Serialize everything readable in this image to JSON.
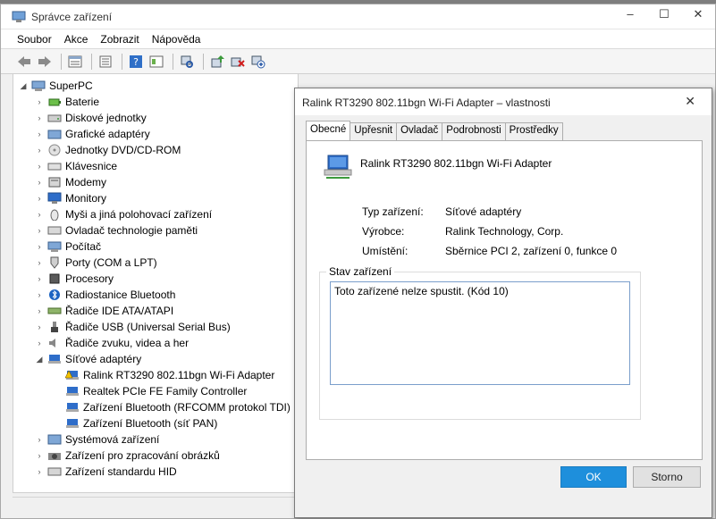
{
  "main_window": {
    "title": "Správce zařízení",
    "controls": {
      "minimize": "–",
      "maximize": "☐",
      "close": "✕"
    }
  },
  "menu": [
    "Soubor",
    "Akce",
    "Zobrazit",
    "Nápověda"
  ],
  "tree": {
    "root": "SuperPC",
    "items": [
      {
        "label": "Baterie",
        "icon": "battery-icon",
        "expanded": false
      },
      {
        "label": "Diskové jednotky",
        "icon": "disk-drive-icon",
        "expanded": false
      },
      {
        "label": "Grafické adaptéry",
        "icon": "display-adapter-icon",
        "expanded": false
      },
      {
        "label": "Jednotky DVD/CD-ROM",
        "icon": "dvd-drive-icon",
        "expanded": false
      },
      {
        "label": "Klávesnice",
        "icon": "keyboard-icon",
        "expanded": false
      },
      {
        "label": "Modemy",
        "icon": "modem-icon",
        "expanded": false
      },
      {
        "label": "Monitory",
        "icon": "monitor-icon",
        "expanded": false
      },
      {
        "label": "Myši a jiná polohovací zařízení",
        "icon": "mouse-icon",
        "expanded": false
      },
      {
        "label": "Ovladač technologie paměti",
        "icon": "memory-controller-icon",
        "expanded": false
      },
      {
        "label": "Počítač",
        "icon": "computer-icon",
        "expanded": false
      },
      {
        "label": "Porty (COM a LPT)",
        "icon": "port-icon",
        "expanded": false
      },
      {
        "label": "Procesory",
        "icon": "processor-icon",
        "expanded": false
      },
      {
        "label": "Radiostanice Bluetooth",
        "icon": "bluetooth-icon",
        "expanded": false
      },
      {
        "label": "Řadiče IDE ATA/ATAPI",
        "icon": "ide-controller-icon",
        "expanded": false
      },
      {
        "label": "Řadiče USB (Universal Serial Bus)",
        "icon": "usb-icon",
        "expanded": false
      },
      {
        "label": "Řadiče zvuku, videa a her",
        "icon": "sound-icon",
        "expanded": false
      },
      {
        "label": "Síťové adaptéry",
        "icon": "network-adapter-icon",
        "expanded": true
      },
      {
        "label": "Systémová zařízení",
        "icon": "system-device-icon",
        "expanded": false
      },
      {
        "label": "Zařízení pro zpracování obrázků",
        "icon": "imaging-device-icon",
        "expanded": false
      },
      {
        "label": "Zařízení standardu HID",
        "icon": "hid-icon",
        "expanded": false
      }
    ],
    "network_children": [
      {
        "label": "Ralink RT3290 802.11bgn Wi-Fi Adapter",
        "warning": true
      },
      {
        "label": "Realtek PCIe FE Family Controller",
        "warning": false
      },
      {
        "label": "Zařízení Bluetooth (RFCOMM protokol TDI)",
        "warning": false
      },
      {
        "label": "Zařízení Bluetooth (síť PAN)",
        "warning": false
      }
    ]
  },
  "dialog": {
    "title": "Ralink RT3290 802.11bgn Wi-Fi Adapter – vlastnosti",
    "close": "✕",
    "tabs": [
      "Obecné",
      "Upřesnit",
      "Ovladač",
      "Podrobnosti",
      "Prostředky"
    ],
    "active_tab": "Obecné",
    "device_name": "Ralink RT3290 802.11bgn Wi-Fi Adapter",
    "props": [
      {
        "label": "Typ zařízení:",
        "value": "Síťové adaptéry"
      },
      {
        "label": "Výrobce:",
        "value": "Ralink Technology, Corp."
      },
      {
        "label": "Umístění:",
        "value": "Sběrnice PCI 2, zařízení 0, funkce 0"
      }
    ],
    "status_group_label": "Stav zařízení",
    "status_text": "Toto zařízené nelze spustit. (Kód 10)",
    "ok_label": "OK",
    "cancel_label": "Storno"
  },
  "colors": {
    "accent": "#1e8fdc",
    "warning": "#f2c200"
  }
}
